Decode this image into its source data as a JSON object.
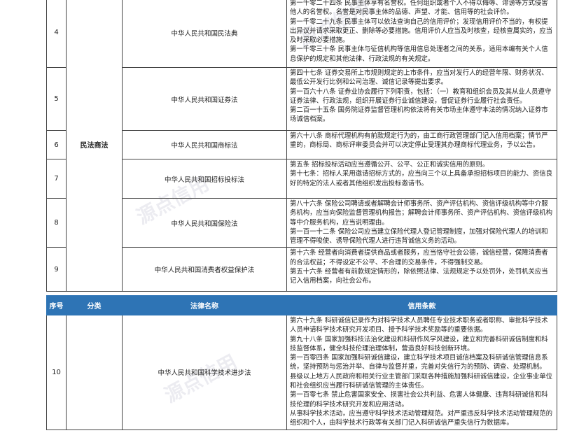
{
  "watermark": "源点信用",
  "header": {
    "num": "序号",
    "category": "分类",
    "law_name": "法律名称",
    "credit_clause": "信用条款"
  },
  "table1": {
    "category": "民法商法",
    "rows": [
      {
        "num": "4",
        "law": "中华人民共和国民法典",
        "lines": [
          "第一千零二十四条  民事主体享有名誉权。任何组织或者个人不得以侮辱、诽谤等方式侵害他人的名誉权。名誉是对民事主体的品德、声望、才能、信用等的社会评价。",
          "第一千零二十九条  民事主体可以依法查询自己的信用评价；发现信用评价不当的，有权提出异议并请求采取更正、删除等必要措施。信用评价人应当及时核查，经核查属实的，应当及时采取必要措施。",
          "第一千零三十条  民事主体与征信机构等信用信息处理者之间的关系，适用本编有关个人信息保护的规定和其他法律、行政法规的有关规定。"
        ]
      },
      {
        "num": "5",
        "law": "中华人民共和国证券法",
        "lines": [
          "第四十七条 证券交易所上市规则规定的上市条件，应当对发行人的经营年限、财务状况、最低公开发行比例和公司治理、诚信记录等提出要求。",
          "第一百六十八条  证券业协会履行下列职责，包括：（一）教育和组织会员及其从业人员遵守证券法律、行政法规，组织开展证券行业诚信建设，督促证券行业履行社会责任。",
          "第二百一十五条  国务院证券监督管理机构依法将有关市场主体遵守本法的情况纳入证券市场诚信档案。"
        ]
      },
      {
        "num": "6",
        "law": "中华人民共和国商标法",
        "lines": [
          "第六十八条    商标代理机构有前款规定行为的，由工商行政管理部门记入信用档案；情节严重的，商标局、商标评审委员会并可以决定停止受理其办理商标代理业务，予以公告。"
        ]
      },
      {
        "num": "7",
        "law": "中华人民共和国招标投标法",
        "lines": [
          "第五条  招标投标活动应当遵循公开、公平、公正和诚实信用的原则。",
          "第十七条：招标人采用邀请招标方式的，应当向三个以上具备承担招标项目的能力、资信良好的特定的法人或者其他组织发出投标邀请书。"
        ]
      },
      {
        "num": "8",
        "law": "中华人民共和国保险法",
        "lines": [
          "第八十六条  保险公司聘请或者解聘会计师事务所、资产评估机构、资信评级机构等中介服务机构，应当向保险监督管理机构报告；解聘会计师事务所、资产评估机构、资信评级机构等中介服务机构，应当说明理由。",
          "第一百一十二条  保险公司应当建立保险代理人登记管理制度，加强对保险代理人的培训和管理不得唆使、诱导保险代理人进行违背诚信义务的活动。"
        ]
      },
      {
        "num": "9",
        "law": "中华人民共和国消费者权益保护法",
        "lines": [
          "第十六条  经营者向消费者提供商品或者服务，应当恪守社会公德，诚信经营，保障消费者的合法权益；不得设定不公平、不合理的交易条件，不得强制交易。",
          "第五十六条  经营者有前款规定情形的，除依照法律、法规规定予以处罚外，处罚机关应当记入信用档案，向社会公布。"
        ]
      }
    ]
  },
  "table2": {
    "rows": [
      {
        "num": "10",
        "law": "中华人民共和国科学技术进步法",
        "lines": [
          "第六十九条  科研诚信记录作为对科学技术人员聘任专业技术职务或者职称、审批科学技术人员申请科学技术研究开发项目、授予科学技术奖励等的重要依据。",
          "第九十八条  国家加强科技法治化建设和科研作风学风建设，建立和完善科研诚信制度和科技监督体系，健全科技伦理治理体制，营造良好科技创新环境。",
          "第一百零四条  国家加强科研诚信建设，建立科学技术项目诚信档案及科研诚信管理信息系统，坚持预防与惩治并举、自律与监督并重，完善对失信行为的预防、调查、处理机制。",
          "县级以上地方人民政府和相关行业主管部门采取各种措施加强科研诚信建设，企业事业单位和社会组织应当履行科研诚信管理的主体责任。",
          "第一百零七条  禁止危害国家安全、损害社会公共利益、危害人体健康、违背科研诚信和科技伦理的科学技术研究开发和应用活动。",
          "从事科学技术活动，应当遵守科学技术活动管理规范。对严重违反科学技术活动管理规范的组织和个人，由科学技术行政等有关部门记入科研诚信严重失信行为数据库。"
        ]
      }
    ]
  }
}
